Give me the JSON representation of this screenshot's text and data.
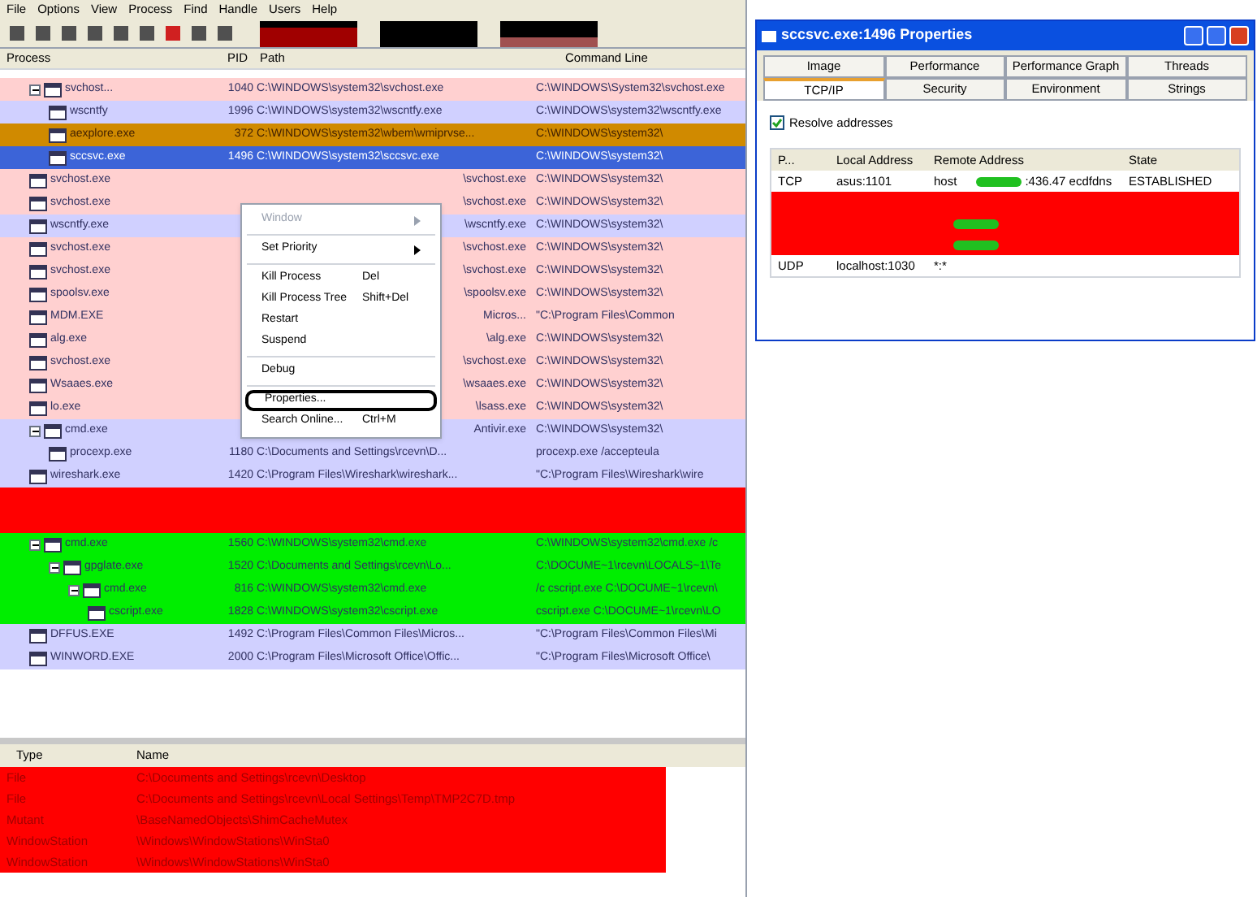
{
  "menu_bar": [
    "File",
    "Options",
    "View",
    "Process",
    "Find",
    "Handle",
    "Users",
    "Help"
  ],
  "process_columns": [
    "Process",
    "PID",
    "Path",
    "Command Line"
  ],
  "processes": [
    {
      "name": "svchost...",
      "pid": "1040",
      "path": "C:\\WINDOWS\\system32\\svchost.exe",
      "cmdline": "C:\\WINDOWS\\System32\\svchost.exe",
      "color": "#ffd0d0",
      "selected": false,
      "expanded": true,
      "children": [
        {
          "name": "wscntfy",
          "pid": "1996",
          "path": "C:\\WINDOWS\\system32\\wscntfy.exe",
          "cmdline": "C:\\WINDOWS\\system32\\wscntfy.exe",
          "color": "#d0d0ff",
          "selected": false
        },
        {
          "name": "aexplore.exe",
          "pid": "372",
          "path": "C:\\WINDOWS\\system32\\wbem\\wmiprvse...",
          "cmdline": "C:\\WINDOWS\\system32\\",
          "color": "#d08a00",
          "selected": false
        },
        {
          "name": "sccsvc.exe",
          "pid": "1496",
          "path": "C:\\WINDOWS\\system32\\sccsvc.exe",
          "cmdline": "C:\\WINDOWS\\system32\\",
          "color": "#3c64d8",
          "selected": true
        }
      ]
    },
    {
      "name": "svchost.exe",
      "path_tail": "\\svchost.exe",
      "cmdline": "C:\\WINDOWS\\system32\\",
      "color": "#ffd0d0",
      "selected": false
    },
    {
      "name": "svchost.exe",
      "path_tail": "\\svchost.exe",
      "cmdline": "C:\\WINDOWS\\system32\\",
      "color": "#ffd0d0",
      "selected": false
    },
    {
      "name": "wscntfy.exe",
      "path_tail": "\\wscntfy.exe",
      "cmdline": "C:\\WINDOWS\\system32\\",
      "color": "#d0d0ff",
      "selected": false
    },
    {
      "name": "svchost.exe",
      "path_tail": "\\svchost.exe",
      "cmdline": "C:\\WINDOWS\\system32\\",
      "color": "#ffd0d0",
      "selected": false
    },
    {
      "name": "svchost.exe",
      "path_tail": "\\svchost.exe",
      "cmdline": "C:\\WINDOWS\\system32\\",
      "color": "#ffd0d0",
      "selected": false
    },
    {
      "name": "spoolsv.exe",
      "path_tail": "\\spoolsv.exe",
      "cmdline": "C:\\WINDOWS\\system32\\",
      "color": "#ffd0d0",
      "selected": false
    },
    {
      "name": "MDM.EXE",
      "path_tail": "Micros...",
      "cmdline": "\"C:\\Program Files\\Common",
      "color": "#ffd0d0",
      "selected": false
    },
    {
      "name": "alg.exe",
      "path_tail": "\\alg.exe",
      "cmdline": "C:\\WINDOWS\\system32\\",
      "color": "#ffd0d0",
      "selected": false
    },
    {
      "name": "svchost.exe",
      "path_tail": "\\svchost.exe",
      "cmdline": "C:\\WINDOWS\\system32\\",
      "color": "#ffd0d0",
      "selected": false
    },
    {
      "name": "Wsaaes.exe",
      "path_tail": "\\wsaaes.exe",
      "cmdline": "C:\\WINDOWS\\system32\\",
      "color": "#ffd0d0",
      "selected": false
    },
    {
      "name": "lo.exe",
      "path_tail": "\\lsass.exe",
      "cmdline": "C:\\WINDOWS\\system32\\",
      "color": "#ffd0d0",
      "selected": false
    },
    {
      "name": "cmd.exe",
      "path_tail": "Antivir.exe",
      "cmdline": "C:\\WINDOWS\\system32\\",
      "color": "#d0d0ff",
      "selected": false,
      "expanded": true,
      "children": [
        {
          "name": "procexp.exe",
          "pid": "1180",
          "path": "C:\\Documents and Settings\\rcevn\\D...",
          "cmdline": "procexp.exe /accepteula",
          "color": "#d0d0ff",
          "selected": false
        }
      ]
    },
    {
      "name": "wireshark.exe",
      "pid": "1420",
      "path": "C:\\Program Files\\Wireshark\\wireshark...",
      "cmdline": "\"C:\\Program Files\\Wireshark\\wire",
      "color": "#d0d0ff",
      "selected": false
    },
    {
      "color": "#ff0000",
      "selected": false
    },
    {
      "color": "#ff0000",
      "selected": false
    },
    {
      "name": "cmd.exe",
      "pid": "1560",
      "path": "C:\\WINDOWS\\system32\\cmd.exe",
      "cmdline": "C:\\WINDOWS\\system32\\cmd.exe /c",
      "color": "#00ee00",
      "selected": false,
      "expanded": true,
      "children": [
        {
          "name": "gpglate.exe",
          "pid": "1520",
          "path": "C:\\Documents and Settings\\rcevn\\Lo...",
          "cmdline": "C:\\DOCUME~1\\rcevn\\LOCALS~1\\Te",
          "color": "#00ee00",
          "selected": false,
          "expanded": true,
          "children": [
            {
              "name": "cmd.exe",
              "pid": "816",
              "path": "C:\\WINDOWS\\system32\\cmd.exe",
              "cmdline": "/c cscript.exe C:\\DOCUME~1\\rcevn\\",
              "color": "#00ee00",
              "selected": false,
              "expanded": true,
              "children": [
                {
                  "name": "cscript.exe",
                  "pid": "1828",
                  "path": "C:\\WINDOWS\\system32\\cscript.exe",
                  "cmdline": "cscript.exe C:\\DOCUME~1\\rcevn\\LO",
                  "color": "#00ee00",
                  "selected": false
                }
              ]
            }
          ]
        }
      ]
    },
    {
      "name": "DFFUS.EXE",
      "pid": "1492",
      "path": "C:\\Program Files\\Common Files\\Micros...",
      "cmdline": "\"C:\\Program Files\\Common Files\\Mi",
      "color": "#d0d0ff",
      "selected": false
    },
    {
      "name": "WINWORD.EXE",
      "pid": "2000",
      "path": "C:\\Program Files\\Microsoft Office\\Offic...",
      "cmdline": "\"C:\\Program Files\\Microsoft Office\\",
      "color": "#d0d0ff",
      "selected": false
    }
  ],
  "context_menu": [
    {
      "kind": "item",
      "label": "Window",
      "disabled": true,
      "submenu": true,
      "circled": false
    },
    {
      "kind": "separator"
    },
    {
      "kind": "item",
      "label": "Set Priority",
      "disabled": false,
      "submenu": true,
      "circled": false
    },
    {
      "kind": "separator"
    },
    {
      "kind": "item",
      "label": "Kill Process",
      "shortcut": "Del",
      "disabled": false,
      "submenu": false,
      "circled": false
    },
    {
      "kind": "item",
      "label": "Kill Process Tree",
      "shortcut": "Shift+Del",
      "disabled": false,
      "submenu": false,
      "circled": false
    },
    {
      "kind": "item",
      "label": "Restart",
      "disabled": false,
      "submenu": false,
      "circled": false
    },
    {
      "kind": "item",
      "label": "Suspend",
      "disabled": false,
      "submenu": false,
      "circled": false
    },
    {
      "kind": "separator"
    },
    {
      "kind": "item",
      "label": "Debug",
      "disabled": false,
      "submenu": false,
      "circled": false
    },
    {
      "kind": "separator"
    },
    {
      "kind": "item",
      "label": "Properties...",
      "disabled": false,
      "submenu": false,
      "circled": true
    },
    {
      "kind": "item",
      "label": "Search Online...",
      "shortcut": "Ctrl+M",
      "disabled": false,
      "submenu": false,
      "circled": false
    }
  ],
  "lower_pane": {
    "columns": [
      "Type",
      "Name"
    ],
    "rows": [
      {
        "type": "File",
        "name": "C:\\Documents and Settings\\rcevn\\Desktop"
      },
      {
        "type": "File",
        "name": "C:\\Documents and Settings\\rcevn\\Local Settings\\Temp\\TMP2C7D.tmp"
      },
      {
        "type": "Mutant",
        "name": "\\BaseNamedObjects\\ShimCacheMutex"
      },
      {
        "type": "WindowStation",
        "name": "\\Windows\\WindowStations\\WinSta0"
      },
      {
        "type": "WindowStation",
        "name": "\\Windows\\WindowStations\\WinSta0"
      }
    ]
  },
  "properties_window": {
    "title": "sccsvc.exe:1496 Properties",
    "tab_rows": [
      [
        {
          "label": "Image",
          "selected": false
        },
        {
          "label": "Performance",
          "selected": false
        },
        {
          "label": "Performance Graph",
          "selected": false
        },
        {
          "label": "Threads",
          "selected": false
        }
      ],
      [
        {
          "label": "TCP/IP",
          "selected": true
        },
        {
          "label": "Security",
          "selected": false
        },
        {
          "label": "Environment",
          "selected": false
        },
        {
          "label": "Strings",
          "selected": false
        }
      ]
    ],
    "resolve_addresses": {
      "label": "Resolve addresses",
      "checked": true
    },
    "columns": [
      "P...",
      "Local Address",
      "Remote Address",
      "State"
    ],
    "connections": [
      {
        "protocol": "TCP",
        "local": "asus:1101",
        "remote_before": "host",
        "redacted": true,
        "remote_after": ":436.47 ecdfdns",
        "state": "ESTABLISHED",
        "color": "#ffffff"
      },
      {
        "redacted": false,
        "color": "#ff0000"
      },
      {
        "redacted": true,
        "color": "#ff0000"
      },
      {
        "redacted": true,
        "color": "#ff0000"
      },
      {
        "protocol": "UDP",
        "local": "localhost:1030",
        "remote_before": "*:*",
        "redacted": false,
        "color": "#ffffff"
      }
    ]
  }
}
